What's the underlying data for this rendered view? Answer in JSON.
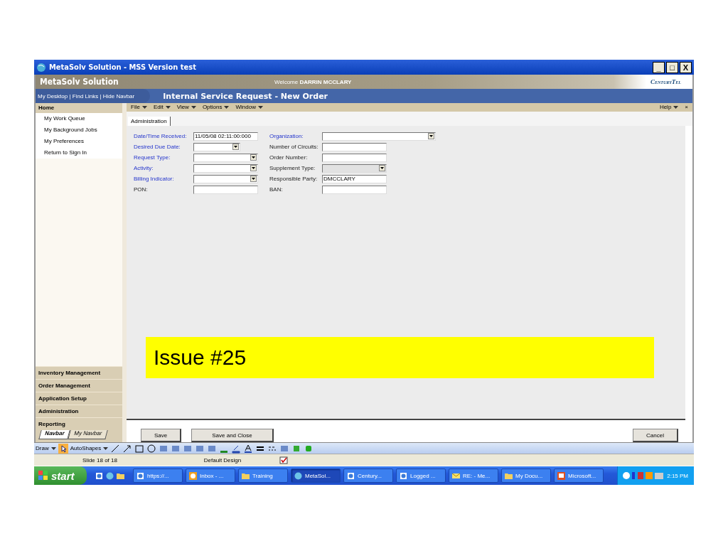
{
  "window": {
    "title": "MetaSolv Solution - MSS Version test",
    "controls": [
      "_",
      "□",
      "X"
    ]
  },
  "header": {
    "app_name": "MetaSolv Solution",
    "welcome": "Welcome",
    "user": "DARRIN MCCLARY",
    "logo": "CenturyTel"
  },
  "navbar": {
    "links": [
      "My Desktop",
      "Find Links",
      "Hide Navbar"
    ],
    "separator": "|",
    "page_title": "Internal Service Request - New Order"
  },
  "sidebar": {
    "home": "Home",
    "items": [
      "My Work Queue",
      "My Background Jobs",
      "My Preferences",
      "Return to Sign In"
    ],
    "sections": [
      "Inventory Management",
      "Order Management",
      "Application Setup",
      "Administration",
      "Reporting"
    ],
    "tabs": [
      {
        "label": "Navbar",
        "selected": true
      },
      {
        "label": "My Navbar",
        "selected": false
      }
    ]
  },
  "menu": {
    "items": [
      "File",
      "Edit",
      "View",
      "Options",
      "Window"
    ],
    "help": "Help",
    "close": "×"
  },
  "tabs": [
    {
      "label": "Administration",
      "selected": true
    }
  ],
  "form": {
    "fields": [
      {
        "label": "Date/Time Received:",
        "required": true,
        "kind": "text",
        "value": "11/05/08 02:11:00:000"
      },
      {
        "label": "Organization:",
        "required": true,
        "kind": "wide-dropdown"
      },
      {
        "label": "Desired Due Date:",
        "required": true,
        "kind": "date-dropdown"
      },
      {
        "label": "Number of Circuits:",
        "required": false,
        "kind": "text"
      },
      {
        "label": "Request Type:",
        "required": true,
        "kind": "dropdown"
      },
      {
        "label": "Order Number:",
        "required": false,
        "kind": "text"
      },
      {
        "label": "Activity:",
        "required": true,
        "kind": "dropdown"
      },
      {
        "label": "Supplement Type:",
        "required": false,
        "kind": "dropdown",
        "disabled": true
      },
      {
        "label": "Billing Indicator:",
        "required": true,
        "kind": "dropdown"
      },
      {
        "label": "Responsible Party:",
        "required": false,
        "kind": "text",
        "value": "DMCCLARY"
      },
      {
        "label": "PON:",
        "required": false,
        "kind": "text"
      },
      {
        "label": "BAN:",
        "required": false,
        "kind": "text"
      }
    ]
  },
  "callout": "Issue #25",
  "buttons": {
    "left": [
      "Save",
      "Save and Close"
    ],
    "right": [
      "Cancel"
    ]
  },
  "office_toolbar": {
    "draw": "Draw",
    "autoshapes": "AutoShapes"
  },
  "status_bar": {
    "slide": "Slide 18 of 18",
    "design": "Default Design"
  },
  "taskbar": {
    "start": "start",
    "items": [
      {
        "label": "https://...",
        "kind": "browser",
        "selected": false
      },
      {
        "label": "Inbox - ...",
        "kind": "mail",
        "selected": false
      },
      {
        "label": "Training",
        "kind": "folder",
        "selected": false
      },
      {
        "label": "MetaSol...",
        "kind": "globe",
        "selected": true
      },
      {
        "label": "Century...",
        "kind": "browser",
        "selected": false
      },
      {
        "label": "Logged ...",
        "kind": "browser",
        "selected": false
      },
      {
        "label": "RE: - Me...",
        "kind": "envelope",
        "selected": false
      },
      {
        "label": "My Docu...",
        "kind": "folder",
        "selected": false
      },
      {
        "label": "Microsoft...",
        "kind": "slides",
        "selected": false
      }
    ],
    "clock": "2:15 PM"
  }
}
